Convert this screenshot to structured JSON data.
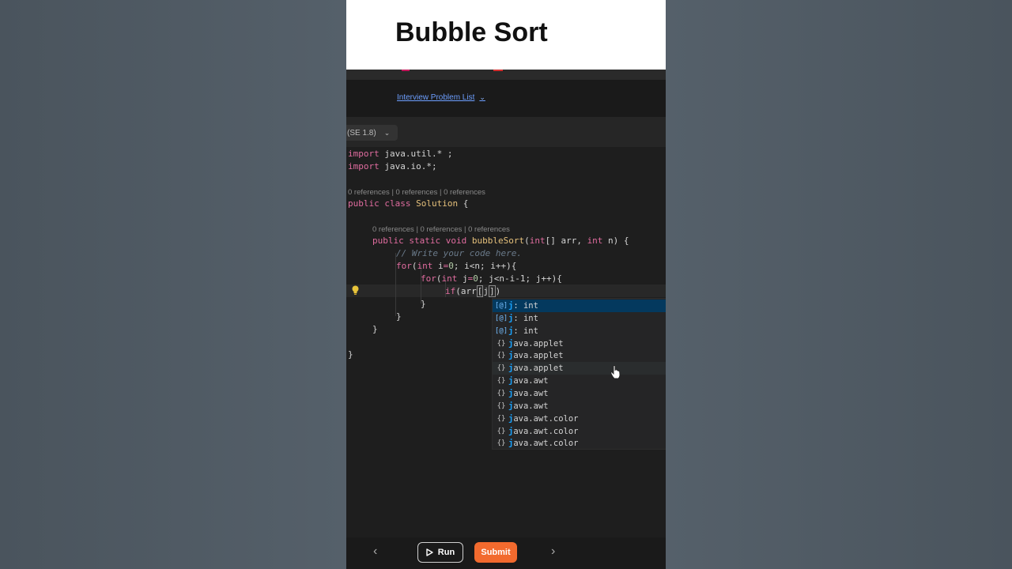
{
  "header": {
    "title": "Bubble Sort"
  },
  "nav": {
    "problem_list_label": "Interview Problem List",
    "chevron": "⌄"
  },
  "language": {
    "selected": "(SE 1.8)"
  },
  "editor": {
    "codelens": [
      "0 references | 0 references | 0 references",
      "0 references | 0 references | 0 references"
    ],
    "lines": {
      "l1_kw": "import",
      "l1_rest": " java.util.* ;",
      "l2_kw": "import",
      "l2_rest": " java.io.*;",
      "l4_kw": "public class",
      "l4_cls": " Solution",
      "l4_rest": " {",
      "l6_kw": "public static void",
      "l6_fn": " bubbleSort",
      "l6_p1": "(",
      "l6_t1": "int",
      "l6_p2": "[] arr, ",
      "l6_t2": "int",
      "l6_p3": " n) {",
      "l7": "// Write your code here.",
      "l8_kw": "for",
      "l8_p1": "(",
      "l8_t": "int",
      "l8_v": " i",
      "l8_eq": "=",
      "l8_n": "0",
      "l8_rest": "; i<n; i++){",
      "l9_kw": "for",
      "l9_p1": "(",
      "l9_t": "int",
      "l9_v": " j",
      "l9_eq": "=",
      "l9_n": "0",
      "l9_rest": "; j<n-i-1; j++){",
      "l10_kw": "if",
      "l10_p1": "(arr",
      "l10_b1": "[",
      "l10_v": "j",
      "l10_b2": "]",
      "l10_p2": ")",
      "close1": "}",
      "close2": "}",
      "close3": "}"
    }
  },
  "suggestions": [
    {
      "icon": "[@]",
      "kind": "variable",
      "match": "j",
      "rest": " : int",
      "state": "selected"
    },
    {
      "icon": "[@]",
      "kind": "variable",
      "match": "j",
      "rest": " : int",
      "state": ""
    },
    {
      "icon": "[@]",
      "kind": "variable",
      "match": "j",
      "rest": " : int",
      "state": ""
    },
    {
      "icon": "{}",
      "kind": "module",
      "match": "j",
      "rest": "ava.applet",
      "state": ""
    },
    {
      "icon": "{}",
      "kind": "module",
      "match": "j",
      "rest": "ava.applet",
      "state": ""
    },
    {
      "icon": "{}",
      "kind": "module",
      "match": "j",
      "rest": "ava.applet",
      "state": "hover"
    },
    {
      "icon": "{}",
      "kind": "module",
      "match": "j",
      "rest": "ava.awt",
      "state": ""
    },
    {
      "icon": "{}",
      "kind": "module",
      "match": "j",
      "rest": "ava.awt",
      "state": ""
    },
    {
      "icon": "{}",
      "kind": "module",
      "match": "j",
      "rest": "ava.awt",
      "state": ""
    },
    {
      "icon": "{}",
      "kind": "module",
      "match": "j",
      "rest": "ava.awt.color",
      "state": ""
    },
    {
      "icon": "{}",
      "kind": "module",
      "match": "j",
      "rest": "ava.awt.color",
      "state": ""
    },
    {
      "icon": "{}",
      "kind": "module",
      "match": "j",
      "rest": "ava.awt.color",
      "state": ""
    }
  ],
  "footer": {
    "prev_icon": "‹",
    "next_icon": "›",
    "run_label": "Run",
    "submit_label": "Submit"
  },
  "colors": {
    "submit": "#f26a2e",
    "selection": "#04395e",
    "accent_link": "#6d9fff"
  },
  "icons": [
    "chevron-left-icon",
    "chevron-right-icon",
    "play-icon",
    "lightbulb-icon",
    "hand-pointer-icon",
    "chevron-down-icon"
  ]
}
